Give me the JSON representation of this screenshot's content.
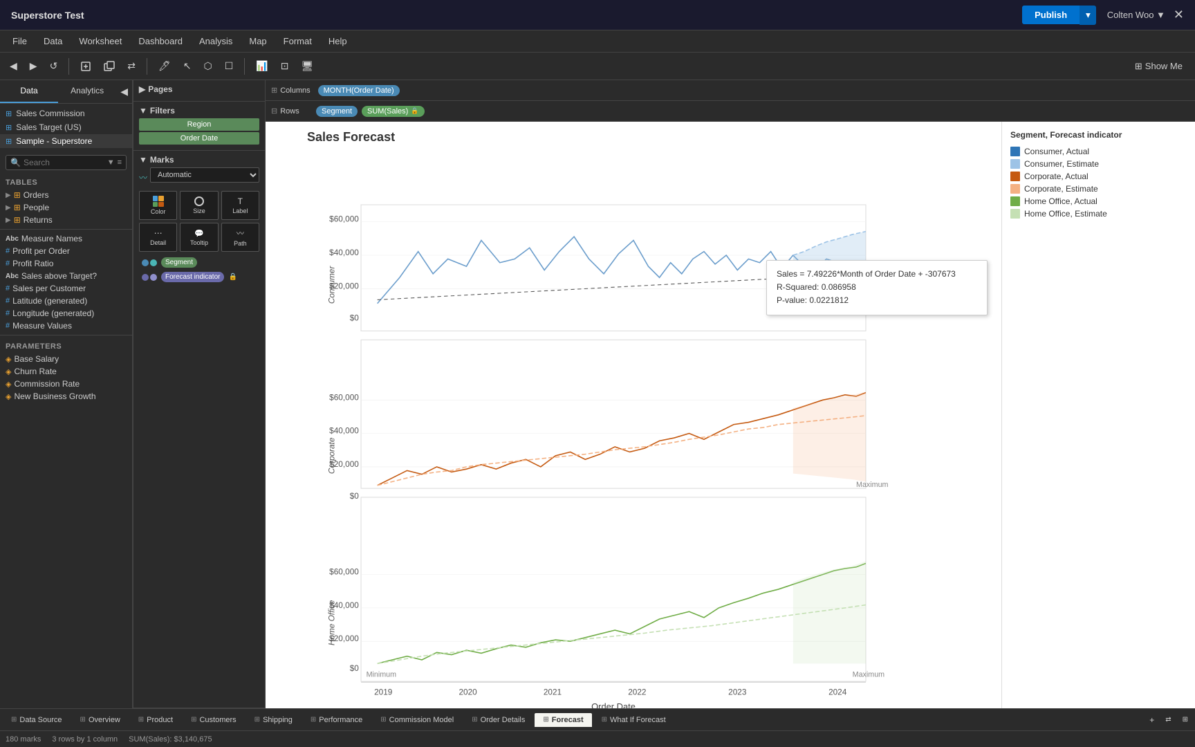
{
  "titleBar": {
    "title": "Superstore Test",
    "publish": "Publish",
    "user": "Colten Woo ▼"
  },
  "menuBar": {
    "items": [
      "File",
      "Data",
      "Worksheet",
      "Dashboard",
      "Analysis",
      "Map",
      "Format",
      "Help"
    ]
  },
  "toolbar": {
    "back": "←",
    "forward": "→",
    "refresh": "↺",
    "showMe": "Show Me"
  },
  "sidebar": {
    "dataTab": "Data",
    "analyticsTab": "Analytics",
    "datasources": [
      {
        "name": "Sales Commission",
        "type": "db"
      },
      {
        "name": "Sales Target (US)",
        "type": "db"
      },
      {
        "name": "Sample - Superstore",
        "type": "db"
      }
    ],
    "searchPlaceholder": "Search",
    "tablesHeader": "Tables",
    "tables": [
      {
        "name": "Orders",
        "type": "table",
        "expanded": true
      },
      {
        "name": "People",
        "type": "table"
      },
      {
        "name": "Returns",
        "type": "table"
      }
    ],
    "fields": [
      {
        "name": "Measure Names",
        "type": "abc"
      },
      {
        "name": "Profit per Order",
        "type": "hash"
      },
      {
        "name": "Profit Ratio",
        "type": "hash"
      },
      {
        "name": "Sales above Target?",
        "type": "abc"
      },
      {
        "name": "Sales per Customer",
        "type": "hash"
      },
      {
        "name": "Latitude (generated)",
        "type": "hash"
      },
      {
        "name": "Longitude (generated)",
        "type": "hash"
      },
      {
        "name": "Measure Values",
        "type": "hash"
      }
    ],
    "paramsHeader": "Parameters",
    "params": [
      {
        "name": "Base Salary"
      },
      {
        "name": "Churn Rate"
      },
      {
        "name": "Commission Rate"
      },
      {
        "name": "New Business Growth"
      }
    ]
  },
  "shelves": {
    "columns": "Columns",
    "rows": "Rows",
    "columnPill": "MONTH(Order Date)",
    "rowPill1": "Segment",
    "rowPill2": "SUM(Sales)"
  },
  "leftPanel": {
    "pages": "Pages",
    "filters": "Filters",
    "filterItems": [
      "Region",
      "Order Date"
    ],
    "marks": "Marks",
    "marksType": "Automatic",
    "marksBtns": [
      "Color",
      "Size",
      "Label",
      "Detail",
      "Tooltip",
      "Path"
    ],
    "marksPills": [
      {
        "name": "Segment",
        "type": "blue"
      },
      {
        "name": "Forecast indicator",
        "type": "teal",
        "locked": true
      }
    ]
  },
  "chart": {
    "title": "Sales Forecast",
    "xLabel": "Order Date",
    "yValues": [
      "$60,000",
      "$40,000",
      "$20,000",
      "$0"
    ],
    "xTicks": [
      "2019",
      "2020",
      "2021",
      "2022",
      "2023",
      "2024"
    ],
    "rowLabels": [
      "Consumer",
      "Corporate",
      "Home Office"
    ],
    "tooltip": {
      "line1": "Sales = 7.49226*Month of Order Date + -307673",
      "line2": "R-Squared: 0.086958",
      "line3": "P-value: 0.0221812"
    },
    "minLabel": "Minimum",
    "maxLabel": "Maximum"
  },
  "legend": {
    "title": "Segment, Forecast indicator",
    "items": [
      {
        "label": "Consumer, Actual",
        "color": "#2e75b6"
      },
      {
        "label": "Consumer, Estimate",
        "color": "#9dc3e6"
      },
      {
        "label": "Corporate, Actual",
        "color": "#c55a11"
      },
      {
        "label": "Corporate, Estimate",
        "color": "#f4b183"
      },
      {
        "label": "Home Office, Actual",
        "color": "#70ad47"
      },
      {
        "label": "Home Office, Estimate",
        "color": "#c5e0b4"
      }
    ]
  },
  "bottomTabs": {
    "icons": [
      "⊞",
      "⊞",
      "⊞",
      "⊞",
      "⊞",
      "⊞",
      "⊞",
      "⊞",
      "⊞",
      "⊞"
    ],
    "tabs": [
      "Data Source",
      "Overview",
      "Product",
      "Customers",
      "Shipping",
      "Performance",
      "Commission Model",
      "Order Details",
      "Forecast",
      "What If Forecast"
    ],
    "activeTab": "Forecast"
  },
  "statusBar": {
    "marks": "180 marks",
    "dimensions": "3 rows by 1 column",
    "sum": "SUM(Sales): $3,140,675"
  }
}
